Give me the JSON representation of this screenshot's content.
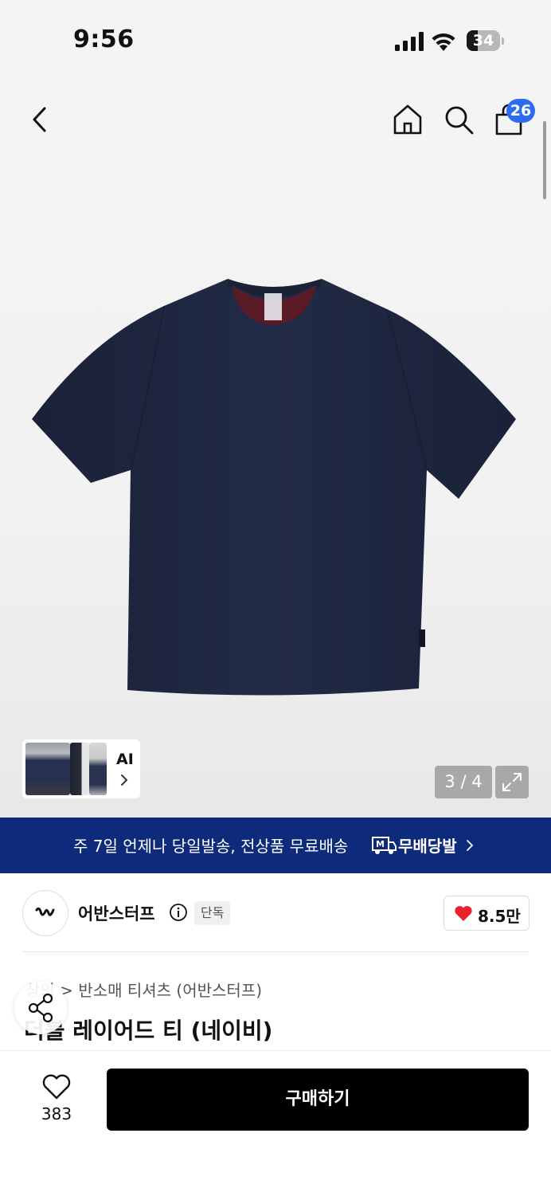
{
  "status_bar": {
    "time": "9:56",
    "battery_level": "34",
    "icons": [
      "signal-icon",
      "wifi-icon",
      "battery-icon"
    ]
  },
  "header": {
    "cart_count": "26",
    "icons": [
      "back-icon",
      "home-icon",
      "search-icon",
      "cart-icon"
    ]
  },
  "gallery": {
    "ai_label": "AI",
    "page_counter": "3 / 4",
    "current_page": 3,
    "total_pages": 4
  },
  "banner": {
    "text": "주 7일 언제나 당일발송, 전상품 무료배송",
    "logo_text": "무배당발",
    "colors": {
      "background": "#0e2a7a"
    }
  },
  "brand": {
    "name": "어반스터프",
    "badge": "단독",
    "likes": "8.5만"
  },
  "product": {
    "breadcrumb_parent": "상의",
    "breadcrumb_sep": ">",
    "breadcrumb_category": "반소매 티셔츠 (어반스터프)",
    "title": "더블 레이어드 티 (네이비)"
  },
  "bottom_bar": {
    "wishlist_count": "383",
    "buy_label": "구매하기"
  },
  "colors": {
    "accent_badge": "#2f6bf0",
    "heart": "#e8222e",
    "primary_button": "#000000",
    "tshirt": "#1f2740"
  }
}
